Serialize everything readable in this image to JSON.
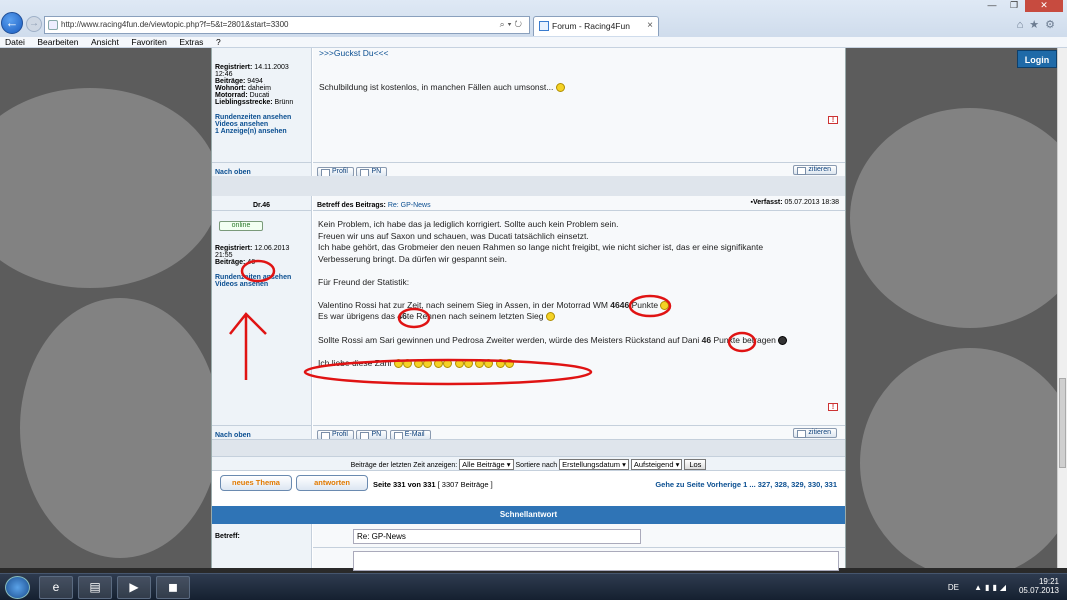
{
  "browser": {
    "url": "http://www.racing4fun.de/viewtopic.php?f=5&t=2801&start=3300",
    "tab_title": "Forum - Racing4Fun",
    "tab_close": "×",
    "window_controls": [
      "—",
      "❐",
      "✕"
    ],
    "menu": [
      "Datei",
      "Bearbeiten",
      "Ansicht",
      "Favoriten",
      "Extras",
      "?"
    ]
  },
  "page": {
    "login": "Login"
  },
  "post1": {
    "quote": ">>>Guckst Du<<<",
    "reg_label": "Registriert:",
    "reg_date": "14.11.2003",
    "reg_time": "12:46",
    "posts_label": "Beiträge:",
    "posts_value": "9494",
    "wohnort_label": "Wohnort:",
    "wohnort_value": "daheim",
    "motorrad_label": "Motorrad:",
    "motorrad_value": "Ducati",
    "strecke_label": "Lieblingsstrecke:",
    "strecke_value": "Brünn",
    "link1": "Rundenzeiten ansehen",
    "link2": "Videos ansehen",
    "link3": "1 Anzeige(n) ansehen",
    "text": "Schulbildung ist kostenlos, in manchen Fällen auch umsonst...",
    "nach_oben": "Nach oben",
    "btn_profil": "Profil",
    "btn_pn": "PN",
    "btn_zitieren": "zitieren"
  },
  "post2": {
    "author": "Dr.46",
    "subject_label": "Betreff des Beitrags:",
    "subject_value": "Re: GP-News",
    "verfasst_label": "Verfasst:",
    "verfasst_value": "05.07.2013 18:38",
    "online": "online",
    "reg_label": "Registriert:",
    "reg_date": "12.06.2013",
    "reg_time": "21:55",
    "posts_label": "Beiträge:",
    "posts_value": "46",
    "link1": "Rundenzeiten ansehen",
    "link2": "Videos ansehen",
    "line1": "Kein Problem, ich habe das ja lediglich korrigiert. Sollte auch kein Problem sein.",
    "line2": "Freuen wir uns auf Saxon und schauen, was Ducati tatsächlich einsetzt.",
    "line3": "Ich habe gehört, das Grobmeier den neuen Rahmen so lange nicht freigibt, wie nicht sicher ist, das er eine signifikante",
    "line4": "Verbesserung bringt. Da dürfen wir gespannt sein.",
    "line5": "Für Freund der Statistik:",
    "line6a": "Valentino Rossi hat zur Zeit, nach seinem Sieg in Assen, in der Motorrad WM",
    "line6b": "4646",
    "line6c": "Punkte",
    "line7a": "Es war übrigens das",
    "line7b": "46",
    "line7c": "te Rennen nach seinem letzten Sieg",
    "line8a": "Sollte Rossi am Sari gewinnen und Pedrosa Zweiter werden, würde des Meisters Rückstand auf Dani",
    "line8b": "46",
    "line8c": "Punkte betragen",
    "line9": "Ich liebe diese Zahl",
    "nach_oben": "Nach oben",
    "btn_profil": "Profil",
    "btn_pn": "PN",
    "btn_email": "E-Mail",
    "btn_zitieren": "zitieren"
  },
  "filter": {
    "label": "Beiträge der letzten Zeit anzeigen:",
    "select1": "Alle Beiträge",
    "sort_label": "Sortiere nach",
    "select2": "Erstellungsdatum",
    "select3": "Aufsteigend",
    "go": "Los"
  },
  "pagination": {
    "btn_new": "neues Thema",
    "btn_reply": "antworten",
    "seite": "Seite 331 von 331",
    "count": "[ 3307 Beiträge ]",
    "goto": "Gehe zu Seite Vorherige",
    "pages": "1 ... 327, 328, 329, 330, 331"
  },
  "quickreply": {
    "title": "Schnellantwort",
    "betreff_label": "Betreff:",
    "betreff_value": "Re: GP-News"
  },
  "taskbar": {
    "lang": "DE",
    "time": "19:21",
    "date": "05.07.2013"
  }
}
